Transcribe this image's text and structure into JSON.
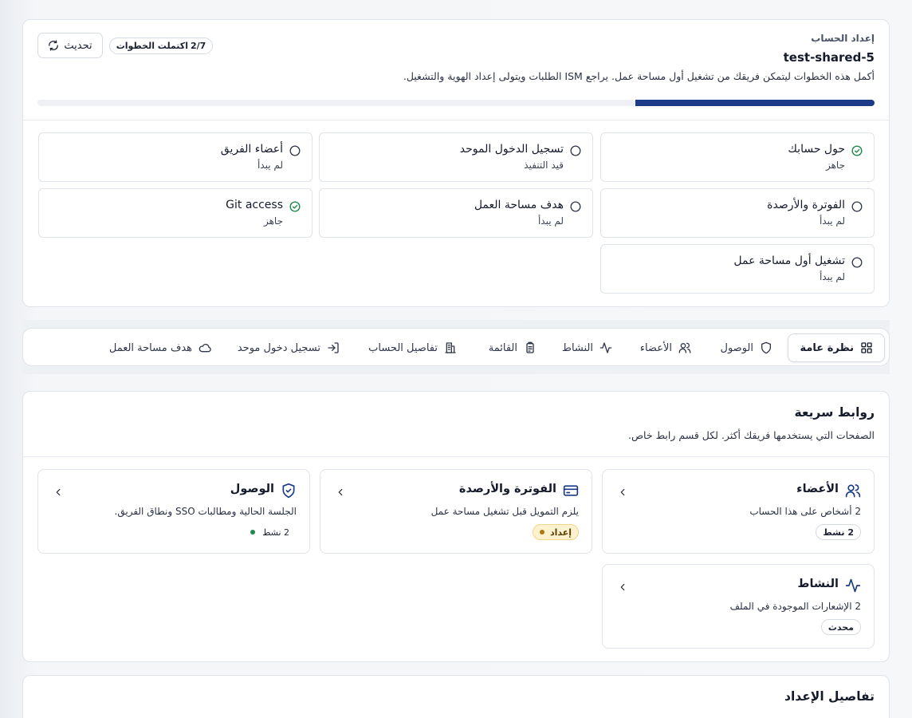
{
  "setup": {
    "eyebrow": "إعداد الحساب",
    "title": "test-shared-5",
    "description": "أكمل هذه الخطوات ليتمكن فريقك من تشغيل أول مساحة عمل. يراجع ISM الطلبات ويتولى إعداد الهوية والتشغيل.",
    "steps_done": "2/7",
    "steps_label": "اكتملت الخطوات",
    "refresh_label": "تحديث",
    "progress_fraction": 0.2857,
    "steps": [
      {
        "name": "حول حسابك",
        "status": "جاهز",
        "done": true
      },
      {
        "name": "تسجيل الدخول الموحد",
        "status": "قيد التنفيذ",
        "done": false
      },
      {
        "name": "أعضاء الفريق",
        "status": "لم يبدأ",
        "done": false
      },
      {
        "name": "الفوترة والأرصدة",
        "status": "لم يبدأ",
        "done": false
      },
      {
        "name": "هدف مساحة العمل",
        "status": "لم يبدأ",
        "done": false
      },
      {
        "name": "Git access",
        "status": "جاهز",
        "done": true
      },
      {
        "name": "تشغيل أول مساحة عمل",
        "status": "لم يبدأ",
        "done": false
      }
    ]
  },
  "tabs": [
    {
      "label": "نظرة عامة",
      "icon": "grid-icon",
      "active": true
    },
    {
      "label": "الوصول",
      "icon": "shield-icon"
    },
    {
      "label": "الأعضاء",
      "icon": "users-icon"
    },
    {
      "label": "النشاط",
      "icon": "activity-icon"
    },
    {
      "label": "القائمة",
      "icon": "clipboard-icon"
    },
    {
      "label": "تفاصيل الحساب",
      "icon": "building-icon"
    },
    {
      "label": "تسجيل دخول موحد",
      "icon": "login-icon"
    },
    {
      "label": "هدف مساحة العمل",
      "icon": "cloud-icon"
    }
  ],
  "quick_links": {
    "title": "روابط سريعة",
    "description": "الصفحات التي يستخدمها فريقك أكثر. لكل قسم رابط خاص.",
    "items": [
      {
        "title": "الأعضاء",
        "icon": "users-icon",
        "description": "2 أشخاص على هذا الحساب",
        "badge": "2 نشط"
      },
      {
        "title": "الفوترة والأرصدة",
        "icon": "credit-card-icon",
        "description": "يلزم التمويل قبل تشغيل مساحة عمل",
        "badge": "إعداد"
      },
      {
        "title": "الوصول",
        "icon": "shield-check-icon",
        "description": "الجلسة الحالية ومطالبات SSO ونطاق الفريق.",
        "badge": "2 نشط"
      },
      {
        "title": "النشاط",
        "icon": "activity-icon",
        "description": "2 الإشعارات الموجودة في الملف",
        "badge": "محدث"
      }
    ]
  },
  "details": {
    "title": "تفاصيل الإعداد"
  },
  "colors": {
    "accent": "#1d3a86",
    "success": "#1f8a4c",
    "warn_bg": "#fdf1cf"
  }
}
